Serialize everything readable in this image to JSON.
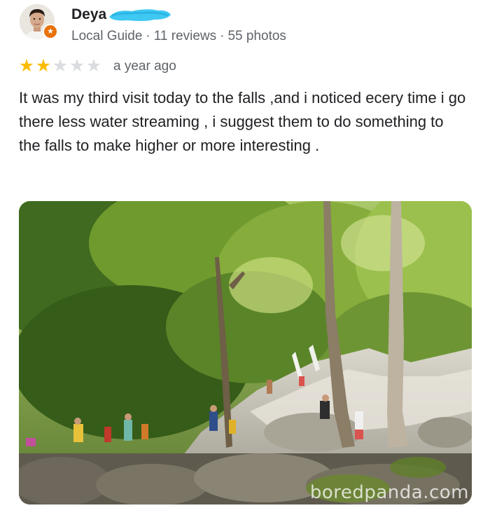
{
  "review": {
    "author": {
      "name": "Deya",
      "avatar_icon": "user-avatar-photo",
      "badge_icon": "local-guide-star-icon",
      "badge_color": "#e8710a"
    },
    "meta": {
      "level": "Local Guide",
      "separator": "·",
      "reviews": "11 reviews",
      "photos": "55 photos"
    },
    "rating": {
      "value": 2,
      "max": 5,
      "star_filled": "★",
      "star_empty": "★",
      "filled_color": "#fbbc04",
      "empty_color": "#dadce0"
    },
    "time": "a year ago",
    "text": "It was my third visit today to the falls ,and i noticed ecery time i go there less water streaming , i suggest them to do something to the falls to make higher or more interesting .",
    "photo": {
      "subject": "visitors-climbing-rocks-at-falls-photo",
      "watermark": "boredpanda.com"
    }
  }
}
